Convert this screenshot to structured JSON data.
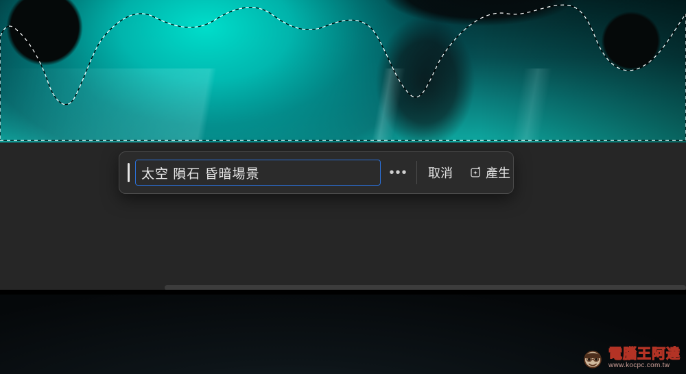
{
  "prompt": {
    "value": "太空 隕石 昏暗場景",
    "placeholder": ""
  },
  "toolbar": {
    "more_label": "•••",
    "cancel_label": "取消",
    "generate_label": "產生"
  },
  "watermark": {
    "title": "電腦王阿達",
    "url": "www.kocpc.com.tw"
  },
  "colors": {
    "accent_border": "#2b6fd6",
    "teal_glow": "#0ecfc0",
    "panel": "#2b2b2b"
  }
}
